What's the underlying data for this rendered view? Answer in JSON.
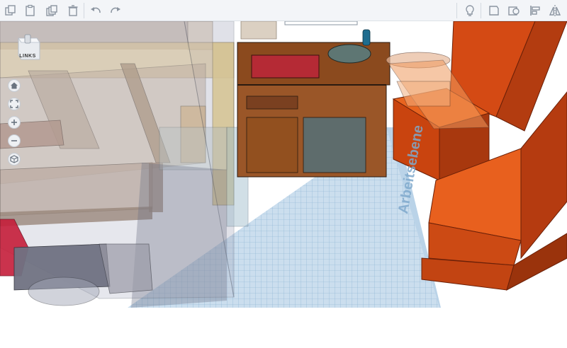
{
  "toolbar": {
    "left_tools": [
      "copy-icon",
      "paste-icon",
      "duplicate-icon",
      "delete-icon",
      "undo-icon",
      "redo-icon"
    ],
    "right_tools": [
      "light-bulb-icon",
      "note-icon",
      "ruler-icon",
      "align-icon",
      "mirror-icon"
    ]
  },
  "viewcube": {
    "label": "LINKS"
  },
  "nav_controls": [
    "home-icon",
    "fit-view-icon",
    "zoom-in-icon",
    "zoom-out-icon",
    "perspective-icon"
  ],
  "workplane": {
    "label": "Arbeitsebene"
  },
  "colors": {
    "toolbar_bg": "#f3f5f8",
    "workplane": "#8fb6d6",
    "cabinet": "#8b4a1e",
    "chair": "#e0561e"
  }
}
